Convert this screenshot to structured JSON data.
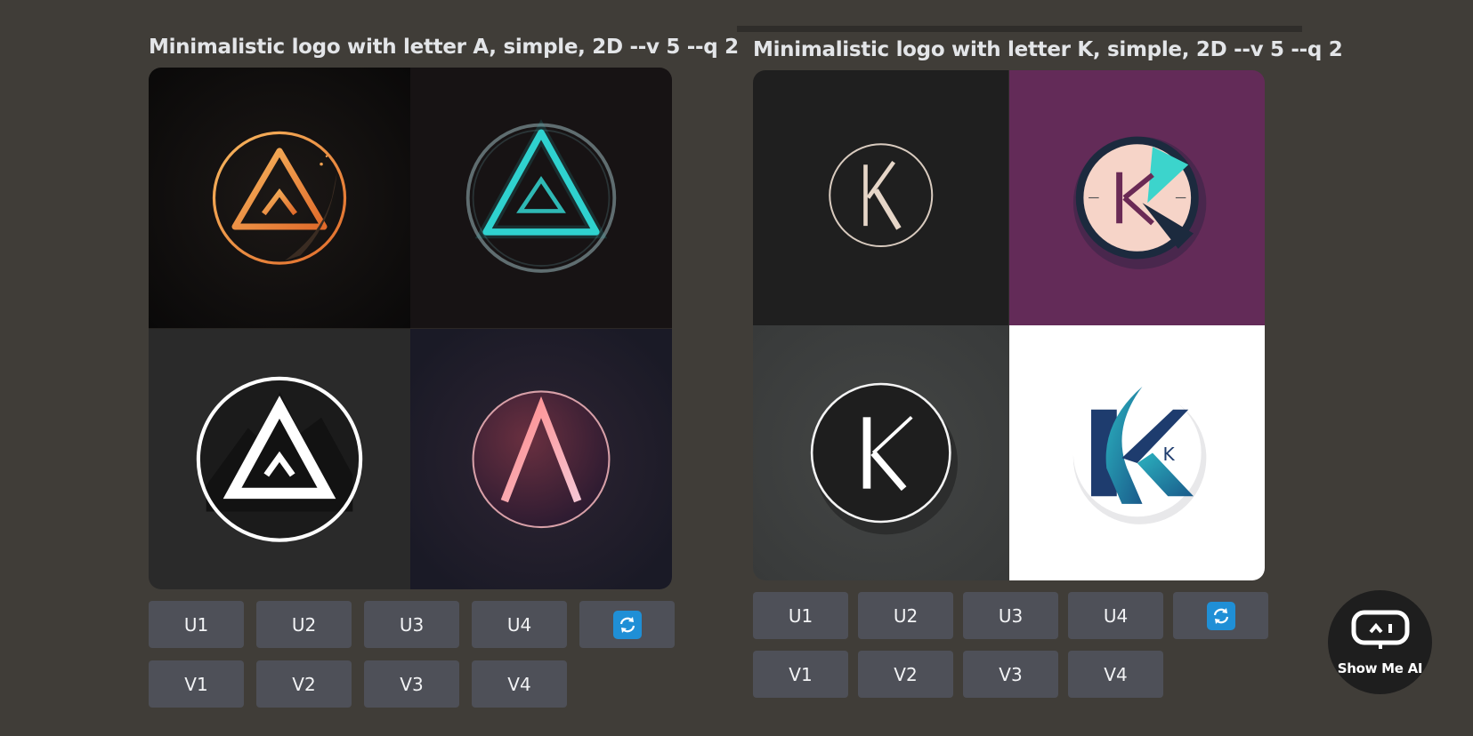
{
  "posts": [
    {
      "prompt": "Minimalistic logo with letter A, simple, 2D --v 5 --q 2",
      "images": [
        "Copper triangle A logo",
        "Teal neon triangle logo",
        "White triangle mountain logo",
        "Rose gradient letter A logo"
      ],
      "upscale_buttons": [
        "U1",
        "U2",
        "U3",
        "U4"
      ],
      "variation_buttons": [
        "V1",
        "V2",
        "V3",
        "V4"
      ],
      "reroll_icon": "refresh-icon"
    },
    {
      "prompt": "Minimalistic logo with letter K, simple, 2D --v 5 --q 2",
      "images": [
        "Beige K monogram in circle",
        "Peach K badge on purple",
        "White K on black circle",
        "Teal and navy K logo"
      ],
      "upscale_buttons": [
        "U1",
        "U2",
        "U3",
        "U4"
      ],
      "variation_buttons": [
        "V1",
        "V2",
        "V3",
        "V4"
      ],
      "reroll_icon": "refresh-icon"
    }
  ],
  "watermark": {
    "text": "Show Me AI",
    "icon": "robot-monitor-icon"
  },
  "colors": {
    "background": "#403d38",
    "button": "#4e5058",
    "button_text": "#f2f3f5",
    "refresh_icon": "#1f8fd6"
  }
}
